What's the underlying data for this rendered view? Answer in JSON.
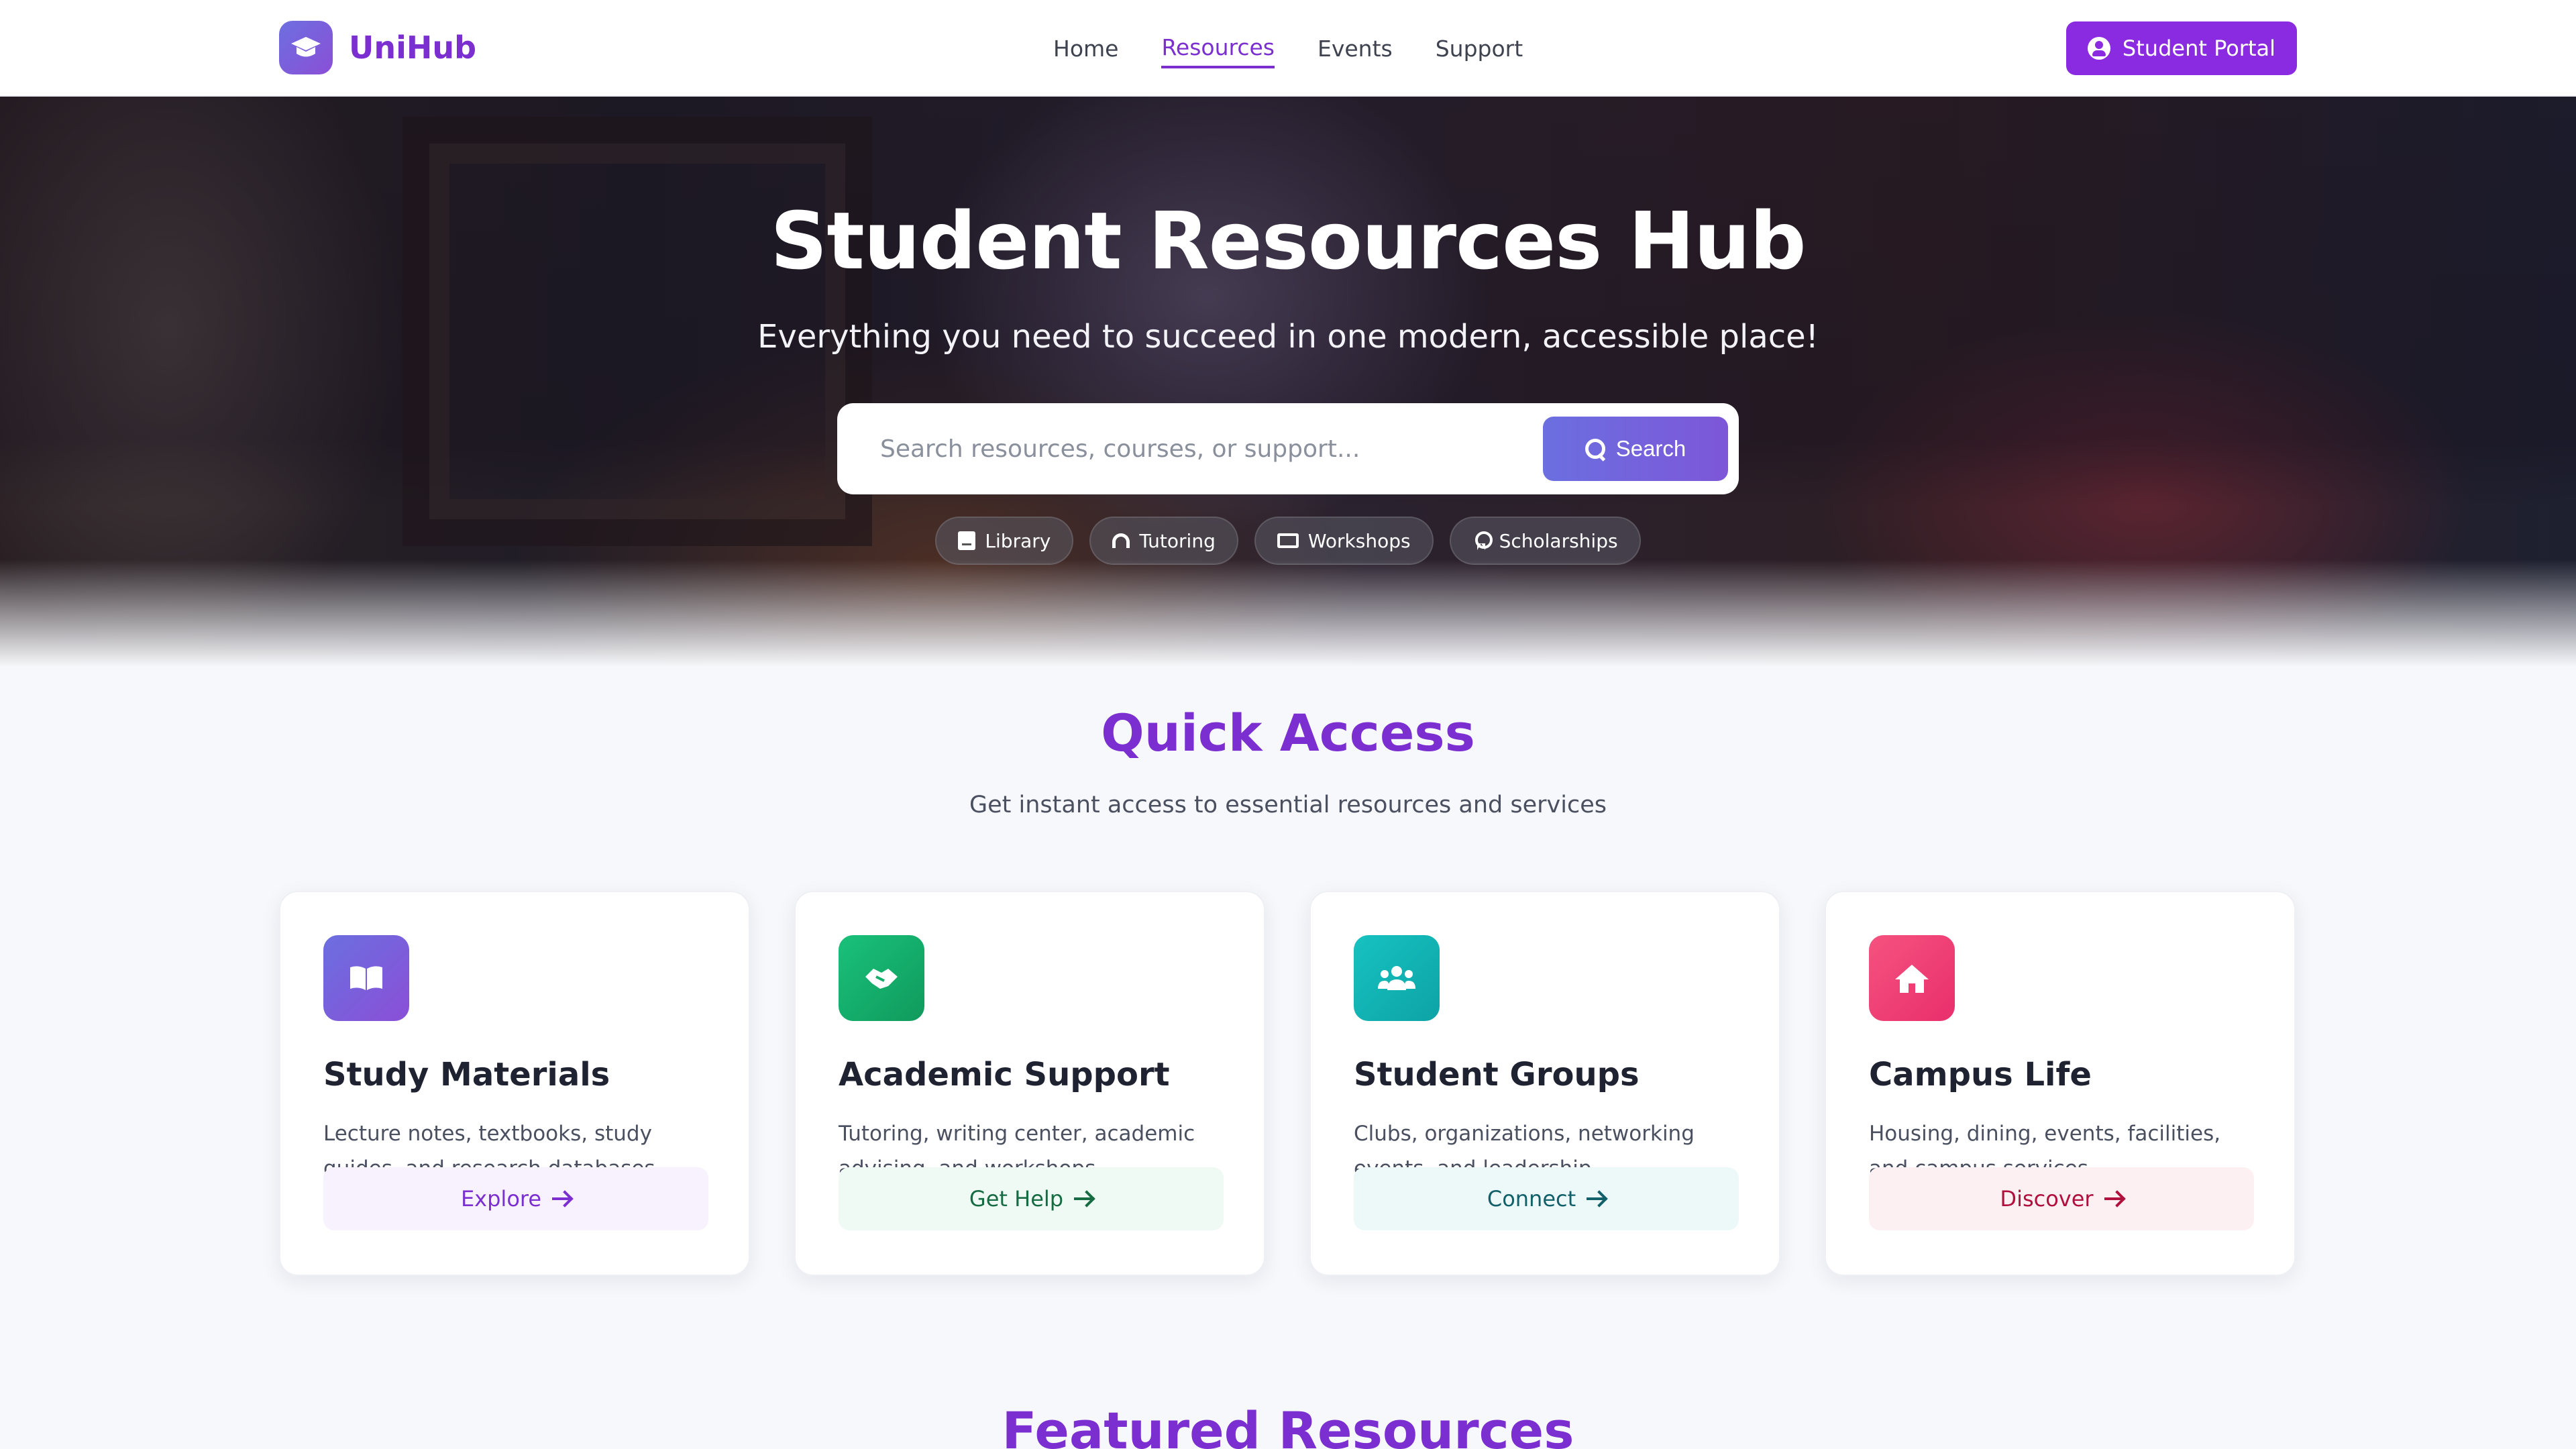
{
  "brand": {
    "name": "UniHub",
    "icon": "graduation-cap-icon"
  },
  "nav": {
    "links": [
      {
        "label": "Home",
        "active": false
      },
      {
        "label": "Resources",
        "active": true
      },
      {
        "label": "Events",
        "active": false
      },
      {
        "label": "Support",
        "active": false
      }
    ],
    "portal_label": "Student Portal",
    "portal_icon": "user-circle-icon"
  },
  "hero": {
    "title": "Student Resources Hub",
    "subtitle": "Everything you need to succeed in one modern, accessible place!",
    "search": {
      "placeholder": "Search resources, courses, or support...",
      "button_label": "Search"
    },
    "chips": [
      {
        "label": "Library",
        "icon": "book-icon"
      },
      {
        "label": "Tutoring",
        "icon": "headset-icon"
      },
      {
        "label": "Workshops",
        "icon": "presentation-icon"
      },
      {
        "label": "Scholarships",
        "icon": "award-icon"
      }
    ]
  },
  "quick_access": {
    "title": "Quick Access",
    "subtitle": "Get instant access to essential resources and services",
    "cards": [
      {
        "title": "Study Materials",
        "description": "Lecture notes, textbooks, study guides, and research databases",
        "button": "Explore",
        "icon": "open-book-icon",
        "color": "#7b55d8",
        "button_bg": "#f7f2fd",
        "button_color": "#7b2fd0"
      },
      {
        "title": "Academic Support",
        "description": "Tutoring, writing center, academic advising, and workshops",
        "button": "Get Help",
        "icon": "handshake-icon",
        "color": "#16b26a",
        "button_bg": "#eefaf3",
        "button_color": "#166b43"
      },
      {
        "title": "Student Groups",
        "description": "Clubs, organizations, networking events, and leadership opportunities",
        "button": "Connect",
        "icon": "users-icon",
        "color": "#12b3b3",
        "button_bg": "#edf9f8",
        "button_color": "#11606a"
      },
      {
        "title": "Campus Life",
        "description": "Housing, dining, events, facilities, and campus services",
        "button": "Discover",
        "icon": "home-icon",
        "color": "#ef3f7c",
        "button_bg": "#fdf0f2",
        "button_color": "#b0103e"
      }
    ]
  },
  "featured": {
    "title": "Featured Resources"
  }
}
